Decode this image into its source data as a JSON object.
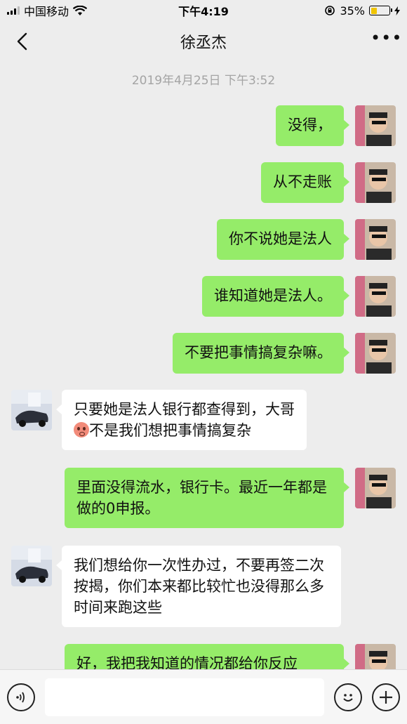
{
  "status_bar": {
    "carrier": "中国移动",
    "time": "下午4:19",
    "battery_percent": "35%",
    "battery_level": 0.35
  },
  "nav": {
    "title": "徐丞杰",
    "more_label": "•••"
  },
  "chat": {
    "timestamp": "2019年4月25日 下午3:52",
    "messages": [
      {
        "side": "me",
        "text": "没得，"
      },
      {
        "side": "me",
        "text": "从不走账"
      },
      {
        "side": "me",
        "text": "你不说她是法人"
      },
      {
        "side": "me",
        "text": "谁知道她是法人。"
      },
      {
        "side": "me",
        "text": "不要把事情搞复杂嘛。"
      },
      {
        "side": "other",
        "line1": "只要她是法人银行都查得到，大哥",
        "line2": "不是我们想把事情搞复杂"
      },
      {
        "side": "me",
        "text": "里面没得流水，银行卡。最近一年都是做的0申报。"
      },
      {
        "side": "other",
        "text": "我们想给你一次性办过，不要再签二次按揭，你们本来都比较忙也没得那么多时间来跑这些"
      },
      {
        "side": "me",
        "text": "好，我把我知道的情况都给你反应"
      }
    ]
  },
  "input": {
    "value": ""
  },
  "colors": {
    "my_bubble": "#95ec69",
    "other_bubble": "#ffffff",
    "background": "#ededed"
  }
}
